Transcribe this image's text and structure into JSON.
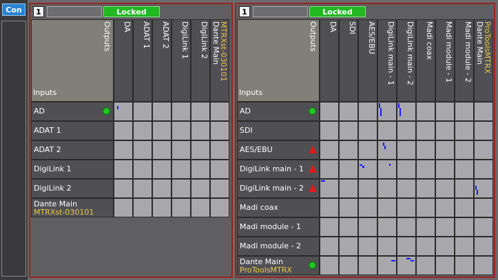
{
  "sidebar": {
    "con_label": "Con"
  },
  "left": {
    "number": "1",
    "status": "Locked",
    "corner": {
      "outputs": "Outputs",
      "inputs": "Inputs"
    },
    "columns": [
      {
        "name": "DA"
      },
      {
        "name": "ADAT 1"
      },
      {
        "name": "ADAT 2"
      },
      {
        "name": "DigiLink 1"
      },
      {
        "name": "DigiLink 2"
      },
      {
        "name": "Dante Main",
        "sub": "MTRXst-030101"
      }
    ],
    "rows": [
      {
        "name": "AD",
        "indicator": "green"
      },
      {
        "name": "ADAT 1"
      },
      {
        "name": "ADAT 2"
      },
      {
        "name": "DigiLink 1"
      },
      {
        "name": "DigiLink 2"
      },
      {
        "name": "Dante Main",
        "sub": "MTRXst-030101"
      }
    ]
  },
  "right": {
    "number": "1",
    "status": "Locked",
    "corner": {
      "outputs": "Outputs",
      "inputs": "Inputs"
    },
    "columns": [
      {
        "name": "DA"
      },
      {
        "name": "SDI"
      },
      {
        "name": "AES/EBU"
      },
      {
        "name": "DigiLink main - 1"
      },
      {
        "name": "DigiLink main - 2"
      },
      {
        "name": "Madi coax"
      },
      {
        "name": "Madi module - 1"
      },
      {
        "name": "Madi module - 2"
      },
      {
        "name": "Dante Main",
        "sub": "ProToolsMTRX"
      }
    ],
    "rows": [
      {
        "name": "AD",
        "indicator": "green"
      },
      {
        "name": "SDI"
      },
      {
        "name": "AES/EBU",
        "indicator": "red"
      },
      {
        "name": "DigiLink main - 1",
        "indicator": "red"
      },
      {
        "name": "DigiLink main - 2",
        "indicator": "red"
      },
      {
        "name": "Madi coax"
      },
      {
        "name": "Madi module - 1"
      },
      {
        "name": "Madi module - 2"
      },
      {
        "name": "Dante Main",
        "sub": "ProToolsMTRX",
        "indicator": "green"
      }
    ]
  },
  "colors": {
    "locked": "#21b821",
    "route_mark": "#1a1aff",
    "warning": "#e01a1a",
    "ok": "#22c422",
    "panel_border": "#9a2222"
  }
}
